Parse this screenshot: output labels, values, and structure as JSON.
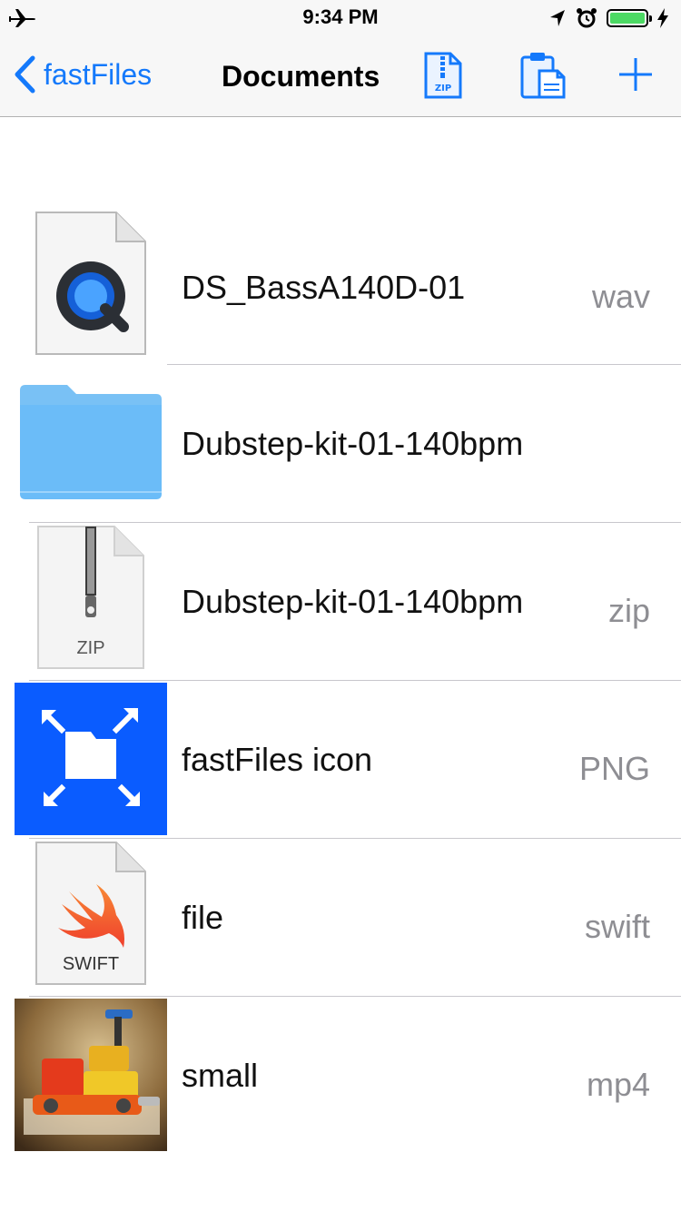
{
  "status_bar": {
    "time": "9:34 PM",
    "airplane_icon": "airplane-icon",
    "location_icon": "location-arrow-icon",
    "alarm_icon": "alarm-clock-icon",
    "battery_level": 1.0,
    "battery_color": "#4cd964",
    "charging_icon": "charging-bolt-icon"
  },
  "nav": {
    "back_label": "fastFiles",
    "title": "Documents",
    "zip_button_text": "ZIP",
    "paste_icon": "clipboard-paste-icon",
    "add_icon": "plus-icon",
    "accent_color": "#1479fb"
  },
  "files": [
    {
      "name": "DS_BassA140D-01",
      "ext": "wav",
      "icon": "quicktime-document-icon"
    },
    {
      "name": "Dubstep-kit-01-140bpm",
      "ext": "",
      "icon": "folder-icon"
    },
    {
      "name": "Dubstep-kit-01-140bpm",
      "ext": "zip",
      "icon": "zip-document-icon",
      "badge": "ZIP"
    },
    {
      "name": "fastFiles icon",
      "ext": "PNG",
      "icon": "fastfiles-app-icon",
      "color": "#0a5cff"
    },
    {
      "name": "file",
      "ext": "swift",
      "icon": "swift-document-icon",
      "badge": "SWIFT"
    },
    {
      "name": "small",
      "ext": "mp4",
      "icon": "video-thumbnail-lego-robot"
    }
  ]
}
